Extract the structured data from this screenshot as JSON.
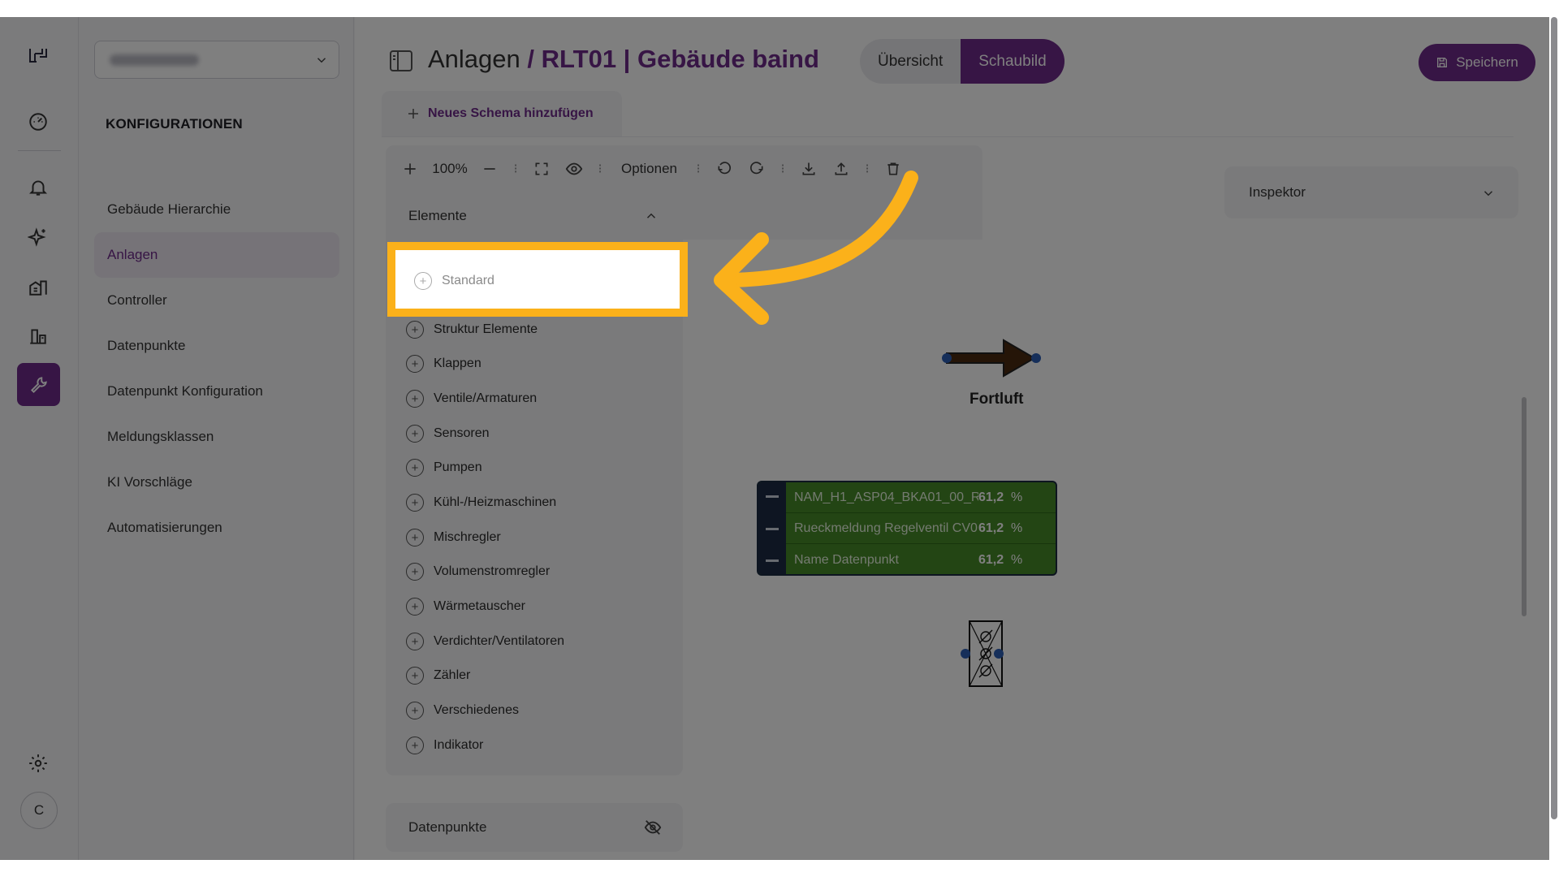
{
  "nav": {
    "section_title": "KONFIGURATIONEN",
    "items": [
      {
        "label": "Gebäude Hierarchie"
      },
      {
        "label": "Anlagen"
      },
      {
        "label": "Controller"
      },
      {
        "label": "Datenpunkte"
      },
      {
        "label": "Datenpunkt Konfiguration"
      },
      {
        "label": "Meldungsklassen"
      },
      {
        "label": "KI Vorschläge"
      },
      {
        "label": "Automatisierungen"
      }
    ],
    "selected": "Anlagen"
  },
  "rail": {
    "avatar_initial": "C",
    "icons": [
      "logo-icon",
      "dashboard-icon",
      "bell-icon",
      "sparkles-icon",
      "buildings-icon",
      "devices-icon",
      "wrench-icon",
      "settings-icon"
    ]
  },
  "header": {
    "breadcrumb_root": "Anlagen",
    "breadcrumb_sep": " / ",
    "breadcrumb_current": "RLT01 | Gebäude baind",
    "tabs": {
      "overview": "Übersicht",
      "diagram": "Schaubild"
    },
    "active_tab": "Schaubild",
    "save_label": "Speichern"
  },
  "schema_tab": {
    "label": "Neues Schema hinzufügen"
  },
  "toolbar": {
    "zoom": "100%",
    "options": "Optionen"
  },
  "elements": {
    "title": "Elemente",
    "items": [
      {
        "label": "Standard"
      },
      {
        "label": "Struktur Elemente"
      },
      {
        "label": "Klappen"
      },
      {
        "label": "Ventile/Armaturen"
      },
      {
        "label": "Sensoren"
      },
      {
        "label": "Pumpen"
      },
      {
        "label": "Kühl-/Heizmaschinen"
      },
      {
        "label": "Mischregler"
      },
      {
        "label": "Volumenstromregler"
      },
      {
        "label": "Wärmetauscher"
      },
      {
        "label": "Verdichter/Ventilatoren"
      },
      {
        "label": "Zähler"
      },
      {
        "label": "Verschiedenes"
      },
      {
        "label": "Indikator"
      }
    ]
  },
  "datapoints_panel": {
    "title": "Datenpunkte"
  },
  "inspector": {
    "title": "Inspektor"
  },
  "canvas": {
    "arrow_label": "Fortluft",
    "table_rows": [
      {
        "name": "NAM_H1_ASP04_BKA01_00_R...",
        "value": "61,2",
        "unit": "%"
      },
      {
        "name": "Rueckmeldung Regelventil CV0...",
        "value": "61,2",
        "unit": "%"
      },
      {
        "name": "Name Datenpunkt",
        "value": "61,2",
        "unit": "%"
      }
    ]
  },
  "colors": {
    "accent": "#6e2a8a",
    "highlight": "#fbb11a",
    "table_bg": "#468a29",
    "arrow": "#4b2a10"
  }
}
